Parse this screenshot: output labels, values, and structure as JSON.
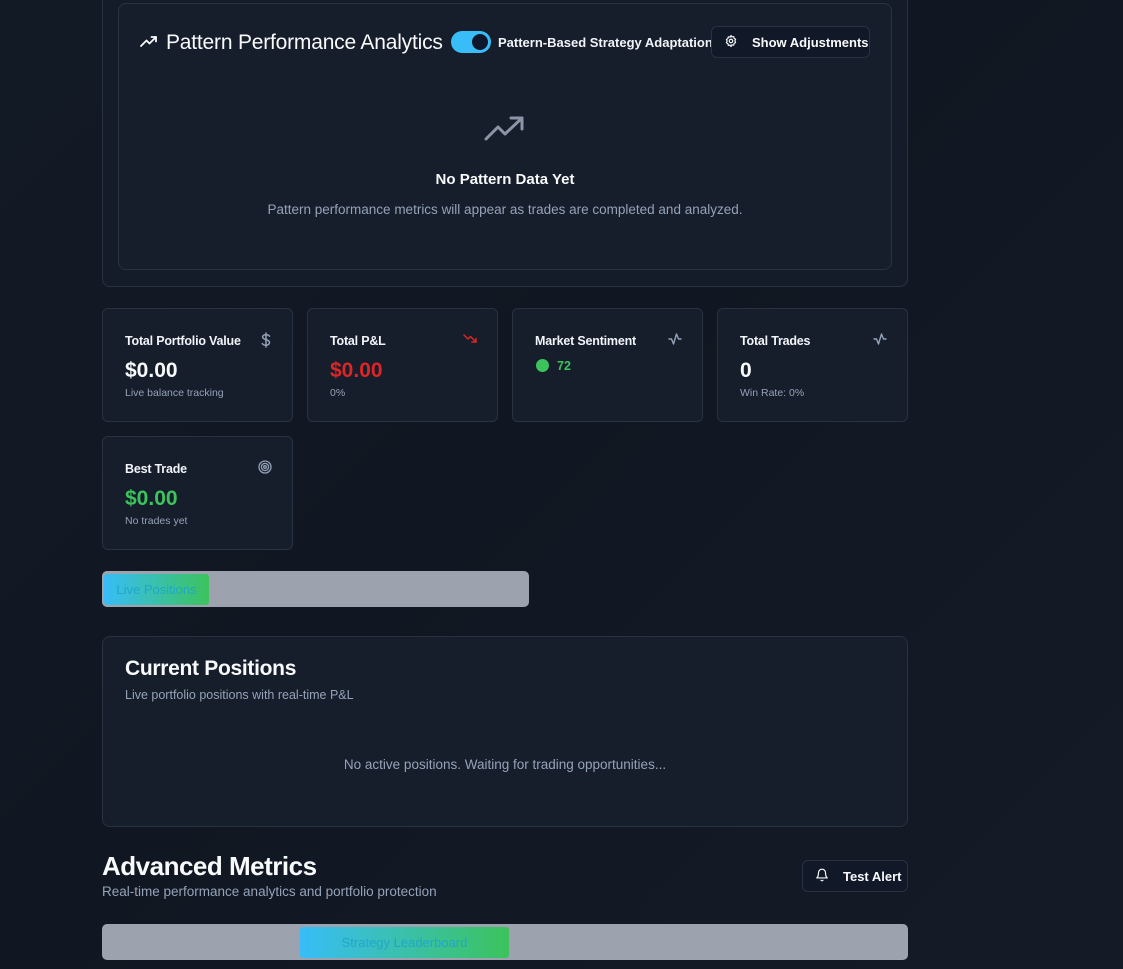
{
  "pattern_analytics": {
    "title": "Pattern Performance Analytics",
    "title_icon": "trending-up-icon",
    "toggle_label": "Pattern-Based Strategy Adaptation",
    "toggle_on": true,
    "adjust_button": "Show Adjustments",
    "adjust_icon": "gear-icon",
    "empty_icon": "trending-up-icon",
    "empty_title": "No Pattern Data Yet",
    "empty_desc": "Pattern performance metrics will appear as trades are completed and analyzed."
  },
  "stats": {
    "portfolio": {
      "title": "Total Portfolio Value",
      "icon": "dollar-icon",
      "value": "$0.00",
      "sub": "Live balance tracking"
    },
    "pnl": {
      "title": "Total P&L",
      "icon": "trending-down-icon",
      "value": "$0.00",
      "sub": "0%"
    },
    "sentiment": {
      "title": "Market Sentiment",
      "icon": "activity-icon",
      "value": "72"
    },
    "trades": {
      "title": "Total Trades",
      "icon": "activity-icon",
      "value": "0",
      "sub": "Win Rate: 0%"
    },
    "best": {
      "title": "Best Trade",
      "icon": "target-icon",
      "value": "$0.00",
      "sub": "No trades yet"
    }
  },
  "tabs": {
    "active": "Live Positions"
  },
  "positions": {
    "title": "Current Positions",
    "subtitle": "Live portfolio positions with real-time P&L",
    "empty": "No active positions. Waiting for trading opportunities..."
  },
  "advanced": {
    "title": "Advanced Metrics",
    "subtitle": "Real-time performance analytics and portfolio protection",
    "alert_button": "Test Alert",
    "alert_icon": "bell-icon",
    "active_tab": "Strategy Leaderboard"
  },
  "colors": {
    "accent": "#38bdf8",
    "positive": "#3cc35c",
    "negative": "#dc2626",
    "muted": "#94a3b8"
  }
}
